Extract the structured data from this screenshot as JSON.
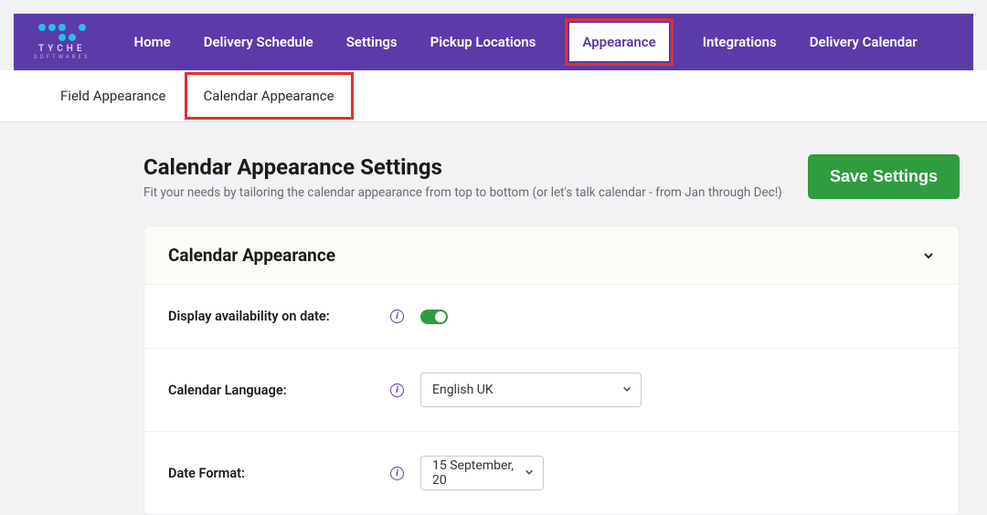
{
  "logo": {
    "name": "TYCHE",
    "sub": "SOFTWARES"
  },
  "nav": {
    "items": [
      {
        "label": "Home"
      },
      {
        "label": "Delivery Schedule"
      },
      {
        "label": "Settings"
      },
      {
        "label": "Pickup Locations"
      },
      {
        "label": "Appearance",
        "active": true
      },
      {
        "label": "Integrations"
      },
      {
        "label": "Delivery Calendar"
      }
    ]
  },
  "subtabs": {
    "items": [
      {
        "label": "Field Appearance"
      },
      {
        "label": "Calendar Appearance",
        "active": true
      }
    ]
  },
  "page": {
    "title": "Calendar Appearance Settings",
    "description": "Fit your needs by tailoring the calendar appearance from top to bottom (or let's talk calendar - from Jan through Dec!)",
    "save_button": "Save Settings"
  },
  "panel": {
    "title": "Calendar Appearance",
    "rows": {
      "availability": {
        "label": "Display availability on date:",
        "enabled": true
      },
      "language": {
        "label": "Calendar Language:",
        "value": "English UK"
      },
      "date_format": {
        "label": "Date Format:",
        "value": "15 September, 20"
      }
    }
  }
}
